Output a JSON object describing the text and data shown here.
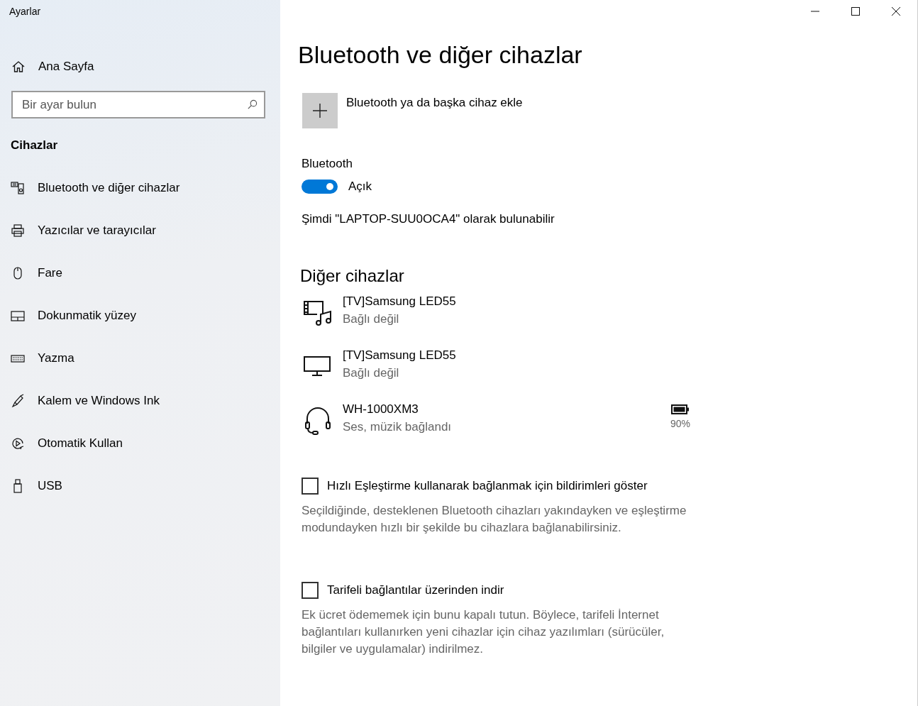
{
  "window": {
    "title": "Ayarlar"
  },
  "sidebar": {
    "home": {
      "label": "Ana Sayfa"
    },
    "search": {
      "placeholder": "Bir ayar bulun"
    },
    "section": "Cihazlar",
    "items": [
      {
        "kind": "devices",
        "label": "Bluetooth ve diğer cihazlar"
      },
      {
        "kind": "printer",
        "label": "Yazıcılar ve tarayıcılar"
      },
      {
        "kind": "mouse",
        "label": "Fare"
      },
      {
        "kind": "touchpad",
        "label": "Dokunmatik yüzey"
      },
      {
        "kind": "keyboard",
        "label": "Yazma"
      },
      {
        "kind": "pen",
        "label": "Kalem ve Windows Ink"
      },
      {
        "kind": "autoplay",
        "label": "Otomatik Kullan"
      },
      {
        "kind": "usb",
        "label": "USB"
      }
    ]
  },
  "main": {
    "title": "Bluetooth ve diğer cihazlar",
    "add_device": "Bluetooth ya da başka cihaz ekle",
    "bluetooth": {
      "label": "Bluetooth",
      "on": true,
      "state": "Açık"
    },
    "discoverable": "Şimdi \"LAPTOP-SUU0OCA4\" olarak bulunabilir",
    "other_heading": "Diğer cihazlar",
    "devices": [
      {
        "kind": "media",
        "name": "[TV]Samsung LED55",
        "status": "Bağlı değil"
      },
      {
        "kind": "monitor",
        "name": "[TV]Samsung LED55",
        "status": "Bağlı değil"
      },
      {
        "kind": "headset",
        "name": "WH-1000XM3",
        "status": "Ses, müzik bağlandı",
        "battery": "90%"
      }
    ],
    "options": [
      {
        "label": "Hızlı Eşleştirme kullanarak bağlanmak için bildirimleri göster",
        "checked": false,
        "description": "Seçildiğinde, desteklenen Bluetooth cihazları yakındayken ve eşleştirme modundayken hızlı bir şekilde bu cihazlara bağlanabilirsiniz."
      },
      {
        "label": "Tarifeli bağlantılar üzerinden indir",
        "checked": false,
        "description": "Ek ücret ödememek için bunu kapalı tutun. Böylece, tarifeli İnternet bağlantıları kullanırken yeni cihazlar için cihaz yazılımları (sürücüler, bilgiler ve uygulamalar) indirilmez."
      }
    ]
  }
}
